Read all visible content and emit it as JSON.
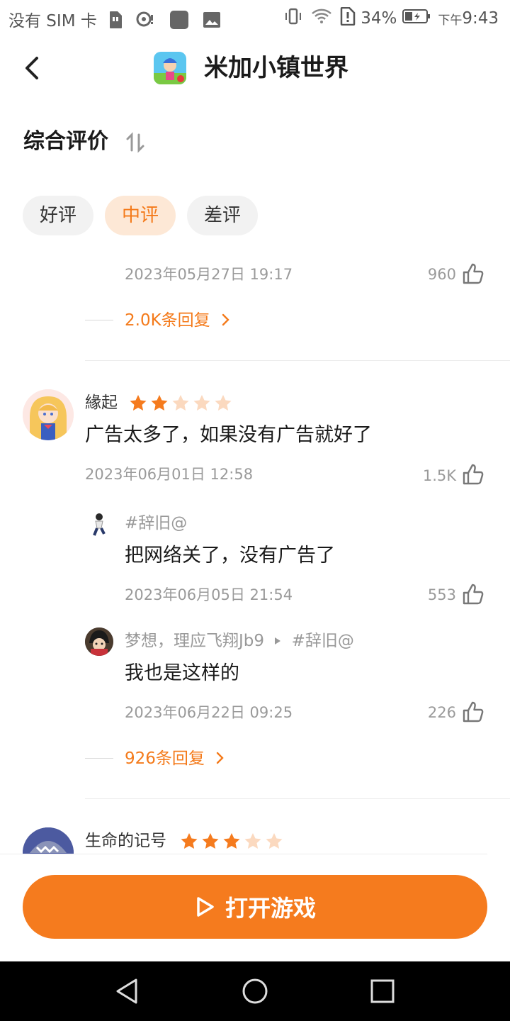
{
  "status_bar": {
    "carrier": "没有 SIM 卡",
    "battery": "34%",
    "time_prefix": "下午",
    "time": "9:43"
  },
  "header": {
    "title": "米加小镇世界"
  },
  "section": {
    "title": "综合评价"
  },
  "filters": [
    {
      "label": "好评",
      "active": false
    },
    {
      "label": "中评",
      "active": true
    },
    {
      "label": "差评",
      "active": false
    }
  ],
  "top_item": {
    "date": "2023年05月27日 19:17",
    "likes": "960",
    "replies": "2.0K条回复"
  },
  "review1": {
    "user": "緣起",
    "rating": 2,
    "text": "广告太多了，如果没有广告就好了",
    "date": "2023年06月01日 12:58",
    "likes": "1.5K",
    "replies": [
      {
        "user": "#辞旧@",
        "text": "把网络关了，没有广告了",
        "date": "2023年06月05日 21:54",
        "likes": "553"
      },
      {
        "user": "梦想，理应飞翔Jb9",
        "reply_to": "#辞旧@",
        "text": "我也是这样的",
        "date": "2023年06月22日 09:25",
        "likes": "226"
      }
    ],
    "more_replies": "926条回复"
  },
  "review2": {
    "user": "生命的记号",
    "rating": 3
  },
  "bottom": {
    "open_button": "打开游戏"
  },
  "colors": {
    "accent": "#f57b1e",
    "chip_active_bg": "#fde8d6",
    "star_on": "#f57b1e",
    "star_off": "#fbd9bf"
  }
}
